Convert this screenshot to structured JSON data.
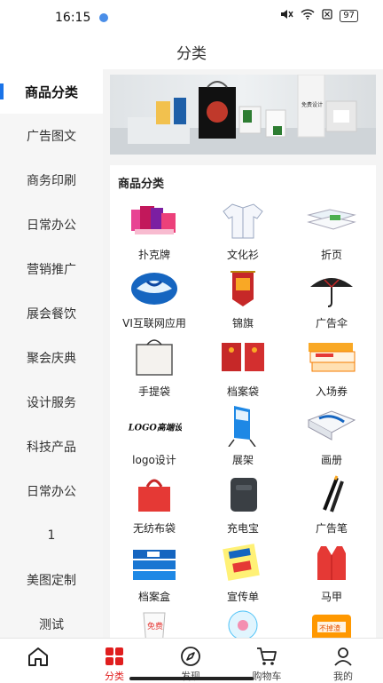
{
  "status_bar": {
    "time": "16:15",
    "battery": "97"
  },
  "header": {
    "title": "分类"
  },
  "sidebar": {
    "items": [
      {
        "label": "商品分类",
        "active": true
      },
      {
        "label": "广告图文"
      },
      {
        "label": "商务印刷"
      },
      {
        "label": "日常办公"
      },
      {
        "label": "营销推广"
      },
      {
        "label": "展会餐饮"
      },
      {
        "label": "聚会庆典"
      },
      {
        "label": "设计服务"
      },
      {
        "label": "科技产品"
      },
      {
        "label": "日常办公"
      },
      {
        "label": "1"
      },
      {
        "label": "美图定制"
      },
      {
        "label": "测试"
      }
    ]
  },
  "main": {
    "section_title": "商品分类",
    "categories": [
      {
        "label": "扑克牌",
        "icon": "playing-cards"
      },
      {
        "label": "文化衫",
        "icon": "shirt"
      },
      {
        "label": "折页",
        "icon": "folded-brochure"
      },
      {
        "label": "VI互联网应用",
        "icon": "vi-logo"
      },
      {
        "label": "锦旗",
        "icon": "pennant"
      },
      {
        "label": "广告伞",
        "icon": "umbrella"
      },
      {
        "label": "手提袋",
        "icon": "tote-bag"
      },
      {
        "label": "档案袋",
        "icon": "file-pouch"
      },
      {
        "label": "入场券",
        "icon": "tickets"
      },
      {
        "label": "logo设计",
        "icon": "logo-design"
      },
      {
        "label": "展架",
        "icon": "display-stand"
      },
      {
        "label": "画册",
        "icon": "brochure-book"
      },
      {
        "label": "无纺布袋",
        "icon": "nonwoven-bag"
      },
      {
        "label": "充电宝",
        "icon": "power-bank"
      },
      {
        "label": "广告笔",
        "icon": "pens"
      },
      {
        "label": "档案盒",
        "icon": "file-box"
      },
      {
        "label": "宣传单",
        "icon": "flyer"
      },
      {
        "label": "马甲",
        "icon": "vest"
      },
      {
        "label": "",
        "icon": "paper-cup"
      },
      {
        "label": "",
        "icon": "fan"
      },
      {
        "label": "",
        "icon": "tissue-pack"
      }
    ],
    "banner_text": {
      "bag_text": "免费设计",
      "box_text": "免费设计"
    },
    "cup_text": "免费",
    "tissue_text": "不掉渣",
    "logo_text": "LOGO高端设计"
  },
  "bottom_nav": {
    "items": [
      {
        "label": "",
        "icon": "home"
      },
      {
        "label": "分类",
        "icon": "category",
        "active": true
      },
      {
        "label": "发现",
        "icon": "compass"
      },
      {
        "label": "购物车",
        "icon": "cart"
      },
      {
        "label": "我的",
        "icon": "user"
      }
    ]
  },
  "colors": {
    "accent": "#e01e1e",
    "sidebar_marker": "#1a73e8",
    "sidebar_bg": "#f6f6f6"
  }
}
